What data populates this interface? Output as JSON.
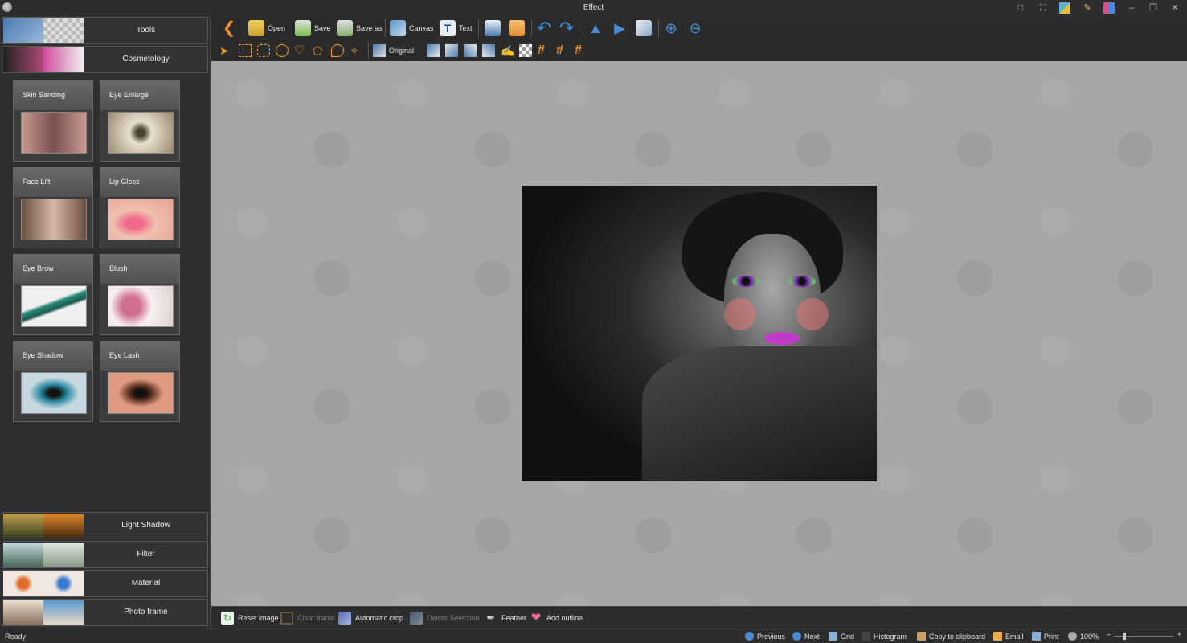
{
  "window": {
    "title": "Effect"
  },
  "sidebar": {
    "categories_top": [
      {
        "label": "Tools",
        "colors": [
          "#4a7ab0",
          "#cfd8e0"
        ]
      },
      {
        "label": "Cosmetology",
        "colors": [
          "#222222",
          "#b04a7a",
          "#e8e8e8"
        ]
      }
    ],
    "effects": [
      {
        "label": "Skin Sanding",
        "colors": [
          "#c89a90",
          "#7a5050"
        ]
      },
      {
        "label": "Eye Enlarge",
        "colors": [
          "#e8e0d0",
          "#9a8a70"
        ]
      },
      {
        "label": "Face Lift",
        "colors": [
          "#d8b8a8",
          "#6a5040"
        ]
      },
      {
        "label": "Lip Gloss",
        "colors": [
          "#f0b0b8",
          "#e8a090"
        ]
      },
      {
        "label": "Eye Brow",
        "colors": [
          "#f0f0f0",
          "#2a8a7a"
        ]
      },
      {
        "label": "Blush",
        "colors": [
          "#f8f0f0",
          "#d07090"
        ]
      },
      {
        "label": "Eye Shadow",
        "colors": [
          "#c8d8e0",
          "#2a8aa0"
        ]
      },
      {
        "label": "Eye Lash",
        "colors": [
          "#e09a80",
          "#5a3020"
        ]
      }
    ],
    "categories_bottom": [
      {
        "label": "Light Shadow",
        "colors": [
          "#6a7040",
          "#c06a2a"
        ]
      },
      {
        "label": "Filter",
        "colors": [
          "#8aa8b0",
          "#c8d0c8"
        ]
      },
      {
        "label": "Material",
        "colors": [
          "#f0e8e0",
          "#3a7ad0",
          "#e06a2a"
        ]
      },
      {
        "label": "Photo frame",
        "colors": [
          "#c8b8a8",
          "#5a9ad0"
        ]
      }
    ]
  },
  "toolbar": {
    "open": "Open",
    "save": "Save",
    "save_as": "Save as",
    "canvas": "Canvas",
    "text": "Text",
    "original": "Original"
  },
  "actions": {
    "reset_image": "Reset image",
    "clear_frame": "Clear frame",
    "automatic_crop": "Automatic crop",
    "delete_selection": "Delete Selection",
    "feather": "Feather",
    "add_outline": "Add outline"
  },
  "status": {
    "text": "Ready",
    "previous": "Previous",
    "next": "Next",
    "grid": "Grid",
    "histogram": "Histogram",
    "copy": "Copy to clipboard",
    "email": "Email",
    "print": "Print",
    "zoom": "100%",
    "zoom_fraction": 0.15
  }
}
